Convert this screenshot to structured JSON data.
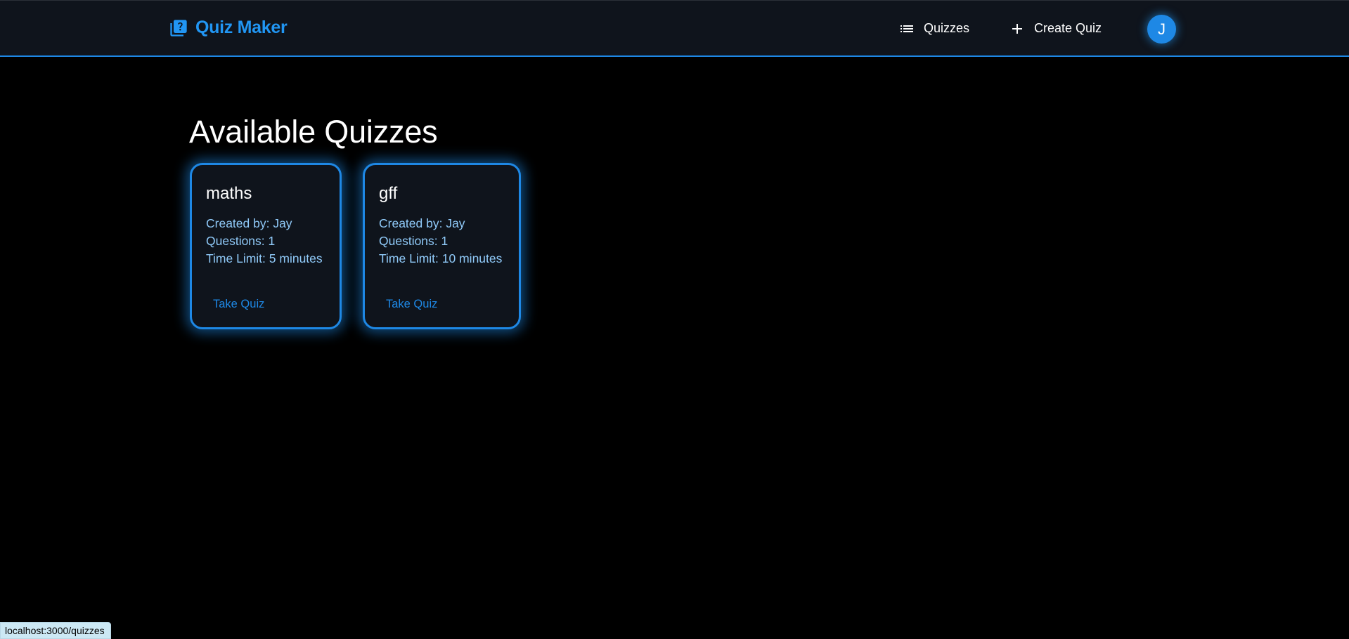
{
  "header": {
    "brand_title": "Quiz Maker",
    "brand_icon": "quiz-icon",
    "nav": [
      {
        "label": "Quizzes",
        "icon": "list-icon"
      },
      {
        "label": "Create Quiz",
        "icon": "plus-icon"
      }
    ],
    "avatar_initial": "J",
    "accent_color": "#2196f3"
  },
  "main": {
    "title": "Available Quizzes",
    "quizzes": [
      {
        "title": "maths",
        "created_by": "Created by: Jay",
        "questions": "Questions: 1",
        "time_limit": "Time Limit: 5 minutes",
        "action_label": "Take Quiz"
      },
      {
        "title": "gff",
        "created_by": "Created by: Jay",
        "questions": "Questions: 1",
        "time_limit": "Time Limit: 10 minutes",
        "action_label": "Take Quiz"
      }
    ]
  },
  "status_bar": {
    "url": "localhost:3000/quizzes"
  }
}
